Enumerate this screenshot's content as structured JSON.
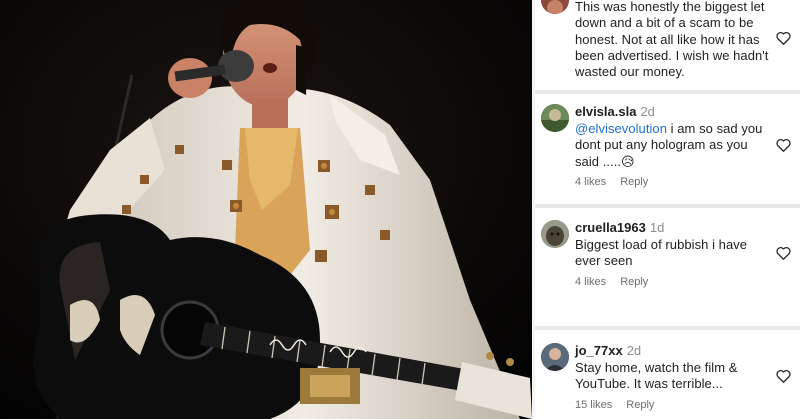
{
  "comments": [
    {
      "username": "",
      "time": "",
      "text": "This was honestly the biggest let down and a bit of a scam to be honest. Not at all like how it has been advertised. I wish we hadn't wasted our money.",
      "likes": "",
      "reply_label": ""
    },
    {
      "username": "elvisla.sla",
      "time": "2d",
      "mention": "@elvisevolution",
      "text": " i am so sad you dont put any hologram as you said .....",
      "emoji": "😥",
      "likes": "4 likes",
      "reply_label": "Reply"
    },
    {
      "username": "cruella1963",
      "time": "1d",
      "text": "Biggest load of rubbish i have ever seen",
      "likes": "4 likes",
      "reply_label": "Reply"
    },
    {
      "username": "jo_77xx",
      "time": "2d",
      "text": "Stay home, watch the film & YouTube. It was terrible...",
      "likes": "15 likes",
      "reply_label": "Reply"
    }
  ],
  "icons": {
    "like": "heart-outline-icon"
  },
  "colors": {
    "mention": "#1e6fd6",
    "separator": "#e8e8e8"
  }
}
